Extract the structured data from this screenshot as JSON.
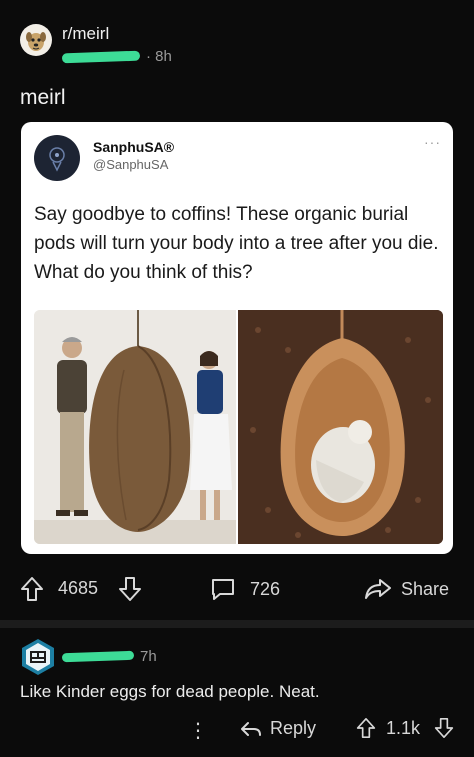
{
  "post": {
    "subreddit": "r/meirl",
    "time": "· 8h",
    "title": "meirl"
  },
  "tweet": {
    "display_name": "SanphuSA®",
    "handle": "@SanphuSA",
    "more": "···",
    "text": "Say goodbye to coffins! These organic burial pods will turn your body into a tree after you die. What do you think of this?"
  },
  "actions": {
    "upvotes": "4685",
    "comments": "726",
    "share": "Share"
  },
  "comment": {
    "time": "7h",
    "text": "Like Kinder eggs for dead people. Neat.",
    "reply": "Reply",
    "score": "1.1k",
    "more": "⋮"
  },
  "colors": {
    "background": "#0b0b0b",
    "redaction": "#3ddc97",
    "text": "#e8e8e8",
    "muted": "#9a9a9a"
  },
  "icons": [
    "subreddit-avatar-icon",
    "upvote-icon",
    "downvote-icon",
    "comment-icon",
    "share-icon",
    "reply-icon",
    "more-icon",
    "user-avatar-icon"
  ]
}
